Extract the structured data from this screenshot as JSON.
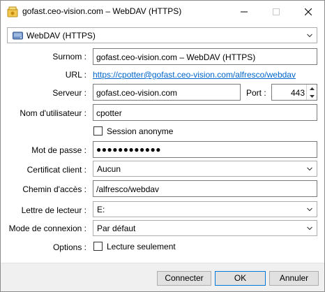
{
  "window": {
    "title": "gofast.ceo-vision.com – WebDAV (HTTPS)"
  },
  "protocol": {
    "selected": "WebDAV (HTTPS)"
  },
  "form": {
    "surnom_label": "Surnom :",
    "surnom_value": "gofast.ceo-vision.com – WebDAV (HTTPS)",
    "url_label": "URL :",
    "url_value": "https://cpotter@gofast.ceo-vision.com/alfresco/webdav",
    "serveur_label": "Serveur :",
    "serveur_value": "gofast.ceo-vision.com",
    "port_label": "Port :",
    "port_value": "443",
    "user_label": "Nom d'utilisateur :",
    "user_value": "cpotter",
    "anon_label": "Session anonyme",
    "password_label": "Mot de passe :",
    "password_value": "●●●●●●●●●●●●",
    "cert_label": "Certificat client :",
    "cert_value": "Aucun",
    "path_label": "Chemin d'accès :",
    "path_value": "/alfresco/webdav",
    "drive_label": "Lettre de lecteur :",
    "drive_value": "E:",
    "mode_label": "Mode de connexion :",
    "mode_value": "Par défaut",
    "options_label": "Options :",
    "readonly_label": "Lecture seulement"
  },
  "buttons": {
    "connect": "Connecter",
    "ok": "OK",
    "cancel": "Annuler"
  },
  "colors": {
    "link": "#0066cc",
    "focus_border": "#0078d7"
  }
}
